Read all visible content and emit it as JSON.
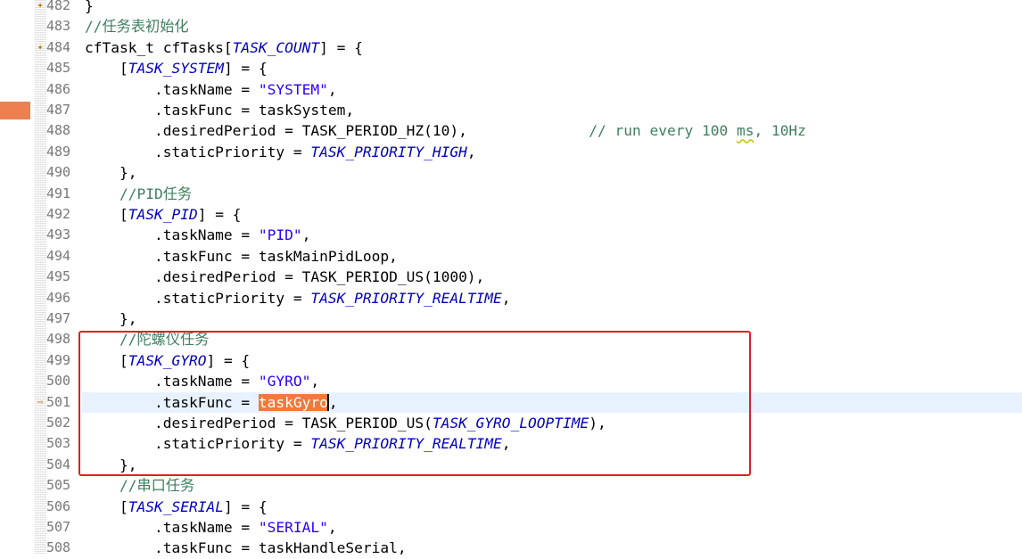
{
  "editor": {
    "lines": [
      {
        "n": "482",
        "code": "}",
        "gutter": "bookmark"
      },
      {
        "n": "483",
        "code": "//任务表初始化"
      },
      {
        "n": "484",
        "code": "cfTask_t cfTasks[TASK_COUNT] = {",
        "gutter": "bookmark"
      },
      {
        "n": "485",
        "code": "    [TASK_SYSTEM] = {"
      },
      {
        "n": "486",
        "code": "        .taskName = \"SYSTEM\","
      },
      {
        "n": "487",
        "code": "        .taskFunc = taskSystem,"
      },
      {
        "n": "488",
        "code": "        .desiredPeriod = TASK_PERIOD_HZ(10),",
        "comment": "// run every 100 ms, 10Hz"
      },
      {
        "n": "489",
        "code": "        .staticPriority = TASK_PRIORITY_HIGH,"
      },
      {
        "n": "490",
        "code": "    },"
      },
      {
        "n": "491",
        "code": "    //PID任务"
      },
      {
        "n": "492",
        "code": "    [TASK_PID] = {"
      },
      {
        "n": "493",
        "code": "        .taskName = \"PID\","
      },
      {
        "n": "494",
        "code": "        .taskFunc = taskMainPidLoop,"
      },
      {
        "n": "495",
        "code": "        .desiredPeriod = TASK_PERIOD_US(1000),"
      },
      {
        "n": "496",
        "code": "        .staticPriority = TASK_PRIORITY_REALTIME,"
      },
      {
        "n": "497",
        "code": "    },"
      },
      {
        "n": "498",
        "code": "    //陀螺仪任务"
      },
      {
        "n": "499",
        "code": "    [TASK_GYRO] = {"
      },
      {
        "n": "500",
        "code": "        .taskName = \"GYRO\","
      },
      {
        "n": "501",
        "code": "        .taskFunc = taskGyro,",
        "gutter": "arrow",
        "current": true
      },
      {
        "n": "502",
        "code": "        .desiredPeriod = TASK_PERIOD_US(TASK_GYRO_LOOPTIME),"
      },
      {
        "n": "503",
        "code": "        .staticPriority = TASK_PRIORITY_REALTIME,"
      },
      {
        "n": "504",
        "code": "    },"
      },
      {
        "n": "505",
        "code": "    //串口任务"
      },
      {
        "n": "506",
        "code": "    [TASK_SERIAL] = {"
      },
      {
        "n": "507",
        "code": "        .taskName = \"SERIAL\","
      },
      {
        "n": "508",
        "code": "        .taskFunc = taskHandleSerial,"
      }
    ],
    "selected_text": "taskGyro",
    "highlight_box_lines": [
      "498",
      "504"
    ]
  },
  "colors": {
    "comment": "#3f7f5f",
    "string": "#2a00ff",
    "macro": "#0000c0",
    "selection": "#f07a3c",
    "current_line": "#e8f2fe",
    "annotation_box": "#e02020",
    "overview_marker": "#ee7f4f"
  },
  "icons": {
    "bookmark": "bookmark-icon",
    "arrow": "current-line-arrow-icon"
  }
}
